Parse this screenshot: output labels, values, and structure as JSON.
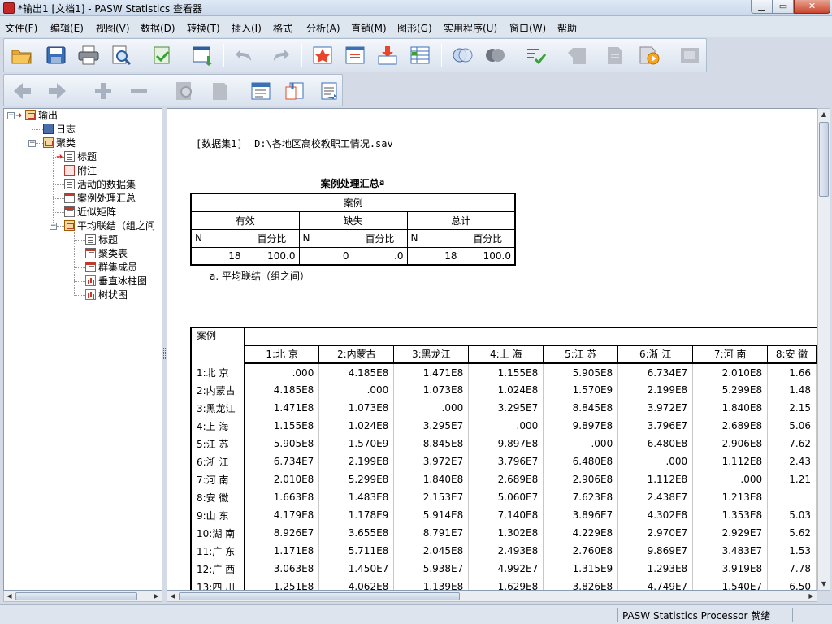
{
  "window": {
    "title": "*输出1 [文档1] - PASW Statistics 查看器"
  },
  "menu": [
    "文件(F)",
    "编辑(E)",
    "视图(V)",
    "数据(D)",
    "转换(T)",
    "插入(I)",
    "格式",
    "分析(A)",
    "直销(M)",
    "图形(G)",
    "实用程序(U)",
    "窗口(W)",
    "帮助"
  ],
  "outline": {
    "root": "输出",
    "log": "日志",
    "cluster": "聚类",
    "cluster_children": [
      "标题",
      "附注",
      "活动的数据集",
      "案例处理汇总",
      "近似矩阵"
    ],
    "linkage": "平均联结（组之间",
    "linkage_children": [
      "标题",
      "聚类表",
      "群集成员",
      "垂直冰柱图",
      "树状图"
    ]
  },
  "content": {
    "dataset_label": "[数据集1]",
    "dataset_path": "D:\\各地区高校教职工情况.sav",
    "summary": {
      "title": "案例处理汇总ª",
      "group_header": "案例",
      "columns": [
        "有效",
        "缺失",
        "总计"
      ],
      "sub_columns": [
        "N",
        "百分比",
        "N",
        "百分比",
        "N",
        "百分比"
      ],
      "values": [
        "18",
        "100.0",
        "0",
        ".0",
        "18",
        "100.0"
      ],
      "footnote": "a. 平均联结（组之间）"
    },
    "proximity": {
      "corner_label": "案例",
      "columns": [
        "1:北 京",
        "2:内蒙古",
        "3:黑龙江",
        "4:上 海",
        "5:江 苏",
        "6:浙 江",
        "7:河 南",
        "8:安 徽"
      ],
      "rows": [
        {
          "label": "1:北 京",
          "values": [
            ".000",
            "4.185E8",
            "1.471E8",
            "1.155E8",
            "5.905E8",
            "6.734E7",
            "2.010E8",
            "1.66"
          ]
        },
        {
          "label": "2:内蒙古",
          "values": [
            "4.185E8",
            ".000",
            "1.073E8",
            "1.024E8",
            "1.570E9",
            "2.199E8",
            "5.299E8",
            "1.48"
          ]
        },
        {
          "label": "3:黑龙江",
          "values": [
            "1.471E8",
            "1.073E8",
            ".000",
            "3.295E7",
            "8.845E8",
            "3.972E7",
            "1.840E8",
            "2.15"
          ]
        },
        {
          "label": "4:上 海",
          "values": [
            "1.155E8",
            "1.024E8",
            "3.295E7",
            ".000",
            "9.897E8",
            "3.796E7",
            "2.689E8",
            "5.06"
          ]
        },
        {
          "label": "5:江 苏",
          "values": [
            "5.905E8",
            "1.570E9",
            "8.845E8",
            "9.897E8",
            ".000",
            "6.480E8",
            "2.906E8",
            "7.62"
          ]
        },
        {
          "label": "6:浙 江",
          "values": [
            "6.734E7",
            "2.199E8",
            "3.972E7",
            "3.796E7",
            "6.480E8",
            ".000",
            "1.112E8",
            "2.43"
          ]
        },
        {
          "label": "7:河 南",
          "values": [
            "2.010E8",
            "5.299E8",
            "1.840E8",
            "2.689E8",
            "2.906E8",
            "1.112E8",
            ".000",
            "1.21"
          ]
        },
        {
          "label": "8:安 徽",
          "values": [
            "1.663E8",
            "1.483E8",
            "2.153E7",
            "5.060E7",
            "7.623E8",
            "2.438E7",
            "1.213E8",
            ""
          ]
        },
        {
          "label": "9:山 东",
          "values": [
            "4.179E8",
            "1.178E9",
            "5.914E8",
            "7.140E8",
            "3.896E7",
            "4.302E8",
            "1.353E8",
            "5.03"
          ]
        },
        {
          "label": "10:湖 南",
          "values": [
            "8.926E7",
            "3.655E8",
            "8.791E7",
            "1.302E8",
            "4.229E8",
            "2.970E7",
            "2.929E7",
            "5.62"
          ]
        },
        {
          "label": "11:广 东",
          "values": [
            "1.171E8",
            "5.711E8",
            "2.045E8",
            "2.493E8",
            "2.760E8",
            "9.869E7",
            "3.483E7",
            "1.53"
          ]
        },
        {
          "label": "12:广 西",
          "values": [
            "3.063E8",
            "1.450E7",
            "5.938E7",
            "4.992E7",
            "1.315E9",
            "1.293E8",
            "3.919E8",
            "7.78"
          ]
        },
        {
          "label": "13:四 川",
          "values": [
            "1.251E8",
            "4.062E8",
            "1.139E8",
            "1.629E8",
            "3.826E8",
            "4.749E7",
            "1.540E7",
            "6.50"
          ]
        }
      ]
    }
  },
  "status": {
    "text": "PASW Statistics Processor 就绪"
  }
}
